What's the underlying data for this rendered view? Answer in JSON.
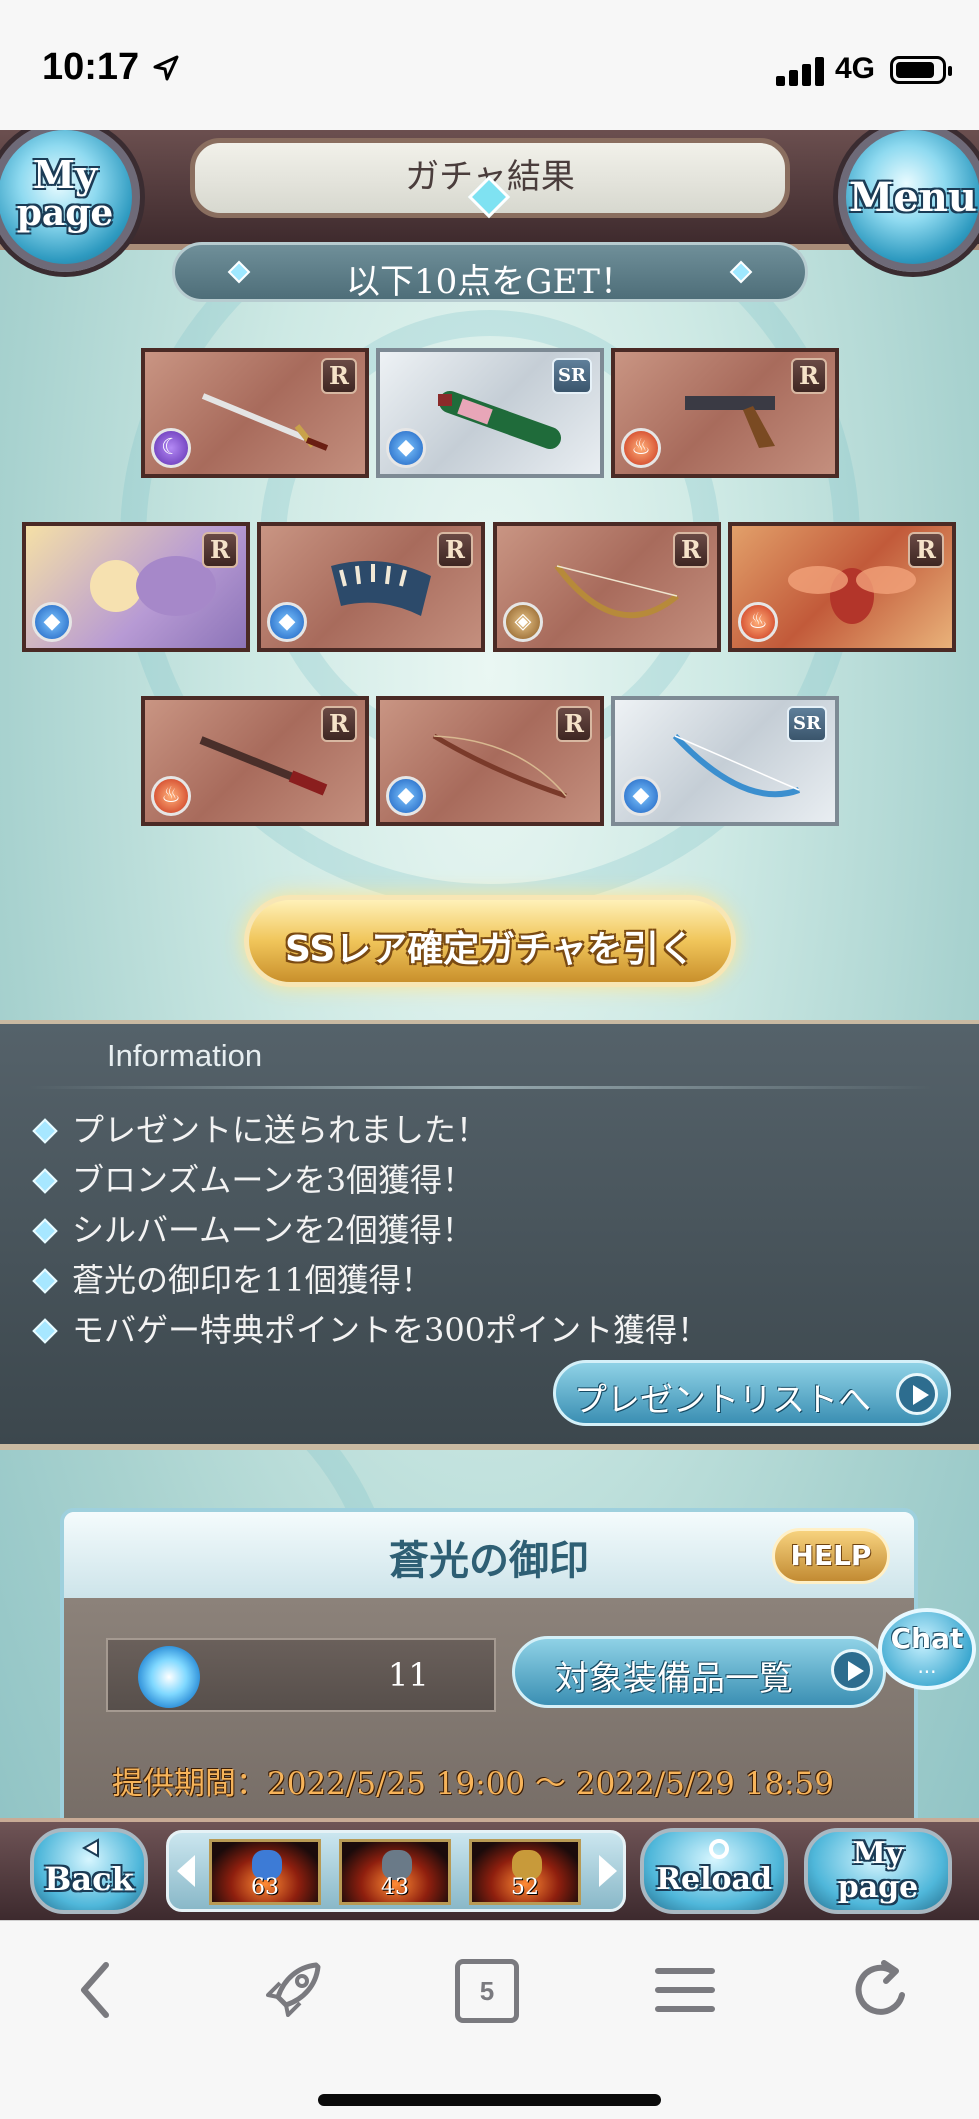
{
  "status_bar": {
    "time": "10:17",
    "network": "4G"
  },
  "header": {
    "title": "ガチャ結果",
    "mypage_line1": "My",
    "mypage_line2": "page",
    "menu_label": "Menu"
  },
  "result": {
    "banner": "以下10点をGET！",
    "items": [
      {
        "rarity": "R",
        "element": "dark",
        "kind": "sword"
      },
      {
        "rarity": "SR",
        "element": "water",
        "kind": "bottle"
      },
      {
        "rarity": "R",
        "element": "fire",
        "kind": "gun"
      },
      {
        "rarity": "R",
        "element": "water",
        "kind": "character"
      },
      {
        "rarity": "R",
        "element": "water",
        "kind": "claw"
      },
      {
        "rarity": "R",
        "element": "earth",
        "kind": "bow"
      },
      {
        "rarity": "R",
        "element": "fire",
        "kind": "summon"
      },
      {
        "rarity": "R",
        "element": "fire",
        "kind": "gun"
      },
      {
        "rarity": "R",
        "element": "water",
        "kind": "bow"
      },
      {
        "rarity": "SR",
        "element": "water",
        "kind": "bow"
      }
    ],
    "ss_button": "SSレア確定ガチャを引く"
  },
  "information": {
    "heading": "Information",
    "messages": [
      "プレゼントに送られました！",
      "ブロンズムーンを3個獲得！",
      "シルバームーンを2個獲得！",
      "蒼光の御印を11個獲得！",
      "モバゲー特典ポイントを300ポイント獲得！"
    ],
    "present_button": "プレゼントリストへ"
  },
  "seal": {
    "title": "蒼光の御印",
    "help": "HELP",
    "count": "11",
    "target_button": "対象装備品一覧",
    "period": "提供期間：2022/5/25 19:00 〜 2022/5/29 18:59"
  },
  "chat": {
    "label": "Chat",
    "dots": "..."
  },
  "game_bar": {
    "back": "Back",
    "reload": "Reload",
    "mypage_line1": "My",
    "mypage_line2": "page",
    "quick_items": [
      {
        "count": "63",
        "color": "#3d7bd6"
      },
      {
        "count": "43",
        "color": "#6a7a88"
      },
      {
        "count": "52",
        "color": "#c89a3a"
      }
    ]
  },
  "browser": {
    "tab_count": "5"
  }
}
